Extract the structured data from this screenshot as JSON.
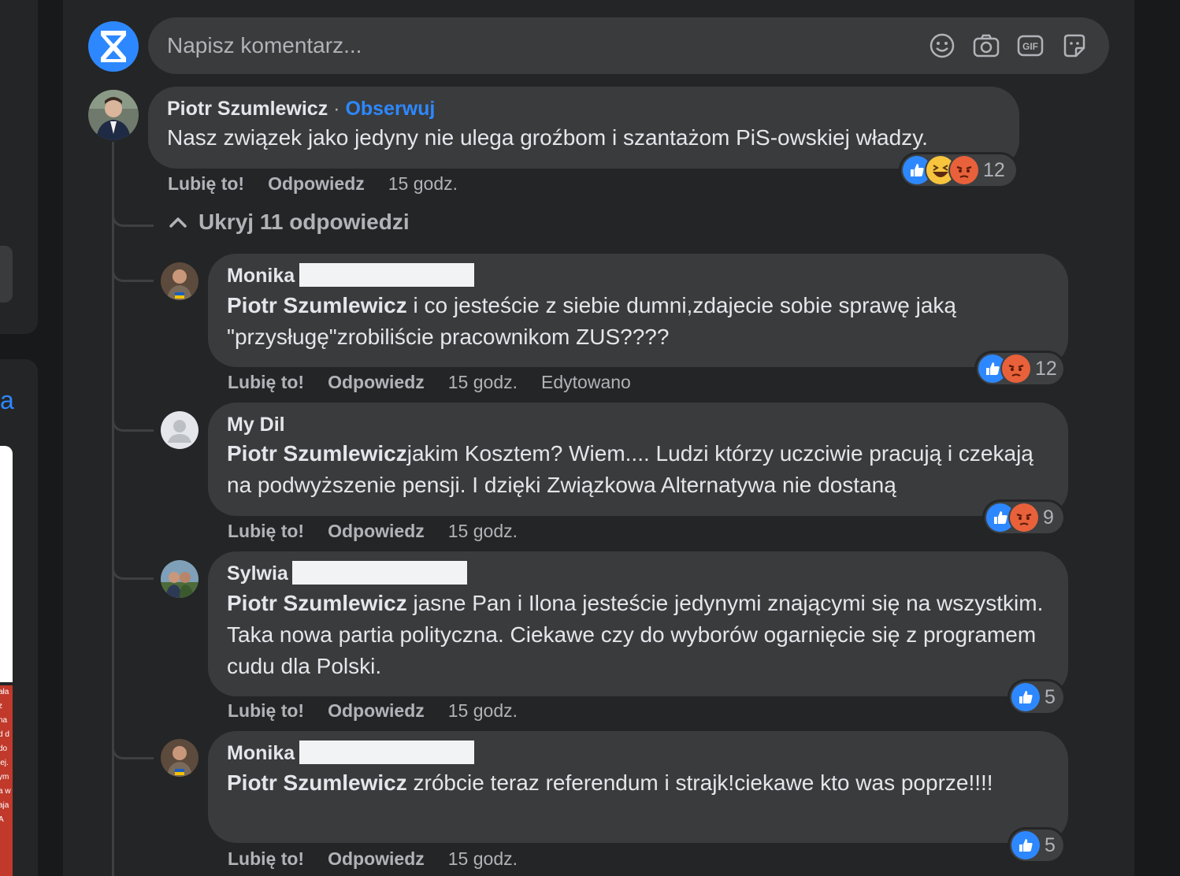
{
  "colors": {
    "accent": "#2d88ff",
    "bubble": "#3a3b3c",
    "panel": "#242526",
    "text": "#e4e6eb",
    "muted": "#b0b3b8"
  },
  "left_edge": {
    "link_fragment": "a",
    "red_text_lines": [
      "ała",
      "z",
      "na",
      "d d",
      "do",
      "iej.",
      "ym",
      "a w",
      "aja",
      "A"
    ]
  },
  "composer": {
    "placeholder": "Napisz komentarz...",
    "icons": [
      "smiley-icon",
      "camera-icon",
      "gif-icon",
      "sticker-icon"
    ]
  },
  "main_comment": {
    "author": "Piotr Szumlewicz",
    "separator": " · ",
    "follow": "Obserwuj",
    "text": "Nasz związek jako jedyny nie ulega groźbom i szantażom PiS-owskiej władzy.",
    "like": "Lubię to!",
    "reply": "Odpowiedz",
    "time": "15 godz.",
    "reactions": {
      "types": [
        "like-icon",
        "haha-icon",
        "angry-icon"
      ],
      "count": "12"
    }
  },
  "toggle": {
    "label": "Ukryj 11 odpowiedzi"
  },
  "replies": [
    {
      "author": "Monika",
      "mention": "Piotr Szumlewicz",
      "text": " i co jesteście z siebie dumni,zdajecie sobie sprawę jaką \"przysługę\"zrobiliście pracownikom ZUS????",
      "like": "Lubię to!",
      "reply": "Odpowiedz",
      "time": "15 godz.",
      "edited": "Edytowano",
      "reactions": {
        "types": [
          "like-icon",
          "angry-icon"
        ],
        "count": "12"
      }
    },
    {
      "author": "My Dil",
      "mention": "Piotr Szumlewicz",
      "text": "jakim Kosztem? Wiem.... Ludzi którzy uczciwie pracują i czekają na podwyższenie pensji. I dzięki Związkowa Alternatywa nie dostaną",
      "like": "Lubię to!",
      "reply": "Odpowiedz",
      "time": "15 godz.",
      "reactions": {
        "types": [
          "like-icon",
          "angry-icon"
        ],
        "count": "9"
      }
    },
    {
      "author": "Sylwia",
      "mention": "Piotr Szumlewicz",
      "text": " jasne Pan i Ilona jesteście jedynymi znającymi się na wszystkim. Taka nowa partia polityczna. Ciekawe czy do wyborów ogarnięcie się z programem cudu dla Polski.",
      "like": "Lubię to!",
      "reply": "Odpowiedz",
      "time": "15 godz.",
      "reactions": {
        "types": [
          "like-icon"
        ],
        "count": "5"
      }
    },
    {
      "author": "Monika",
      "mention": "Piotr Szumlewicz",
      "text": " zróbcie teraz referendum i strajk!ciekawe kto was poprze!!!!",
      "like": "Lubię to!",
      "reply": "Odpowiedz",
      "time": "15 godz.",
      "reactions": {
        "types": [
          "like-icon"
        ],
        "count": "5"
      }
    }
  ]
}
